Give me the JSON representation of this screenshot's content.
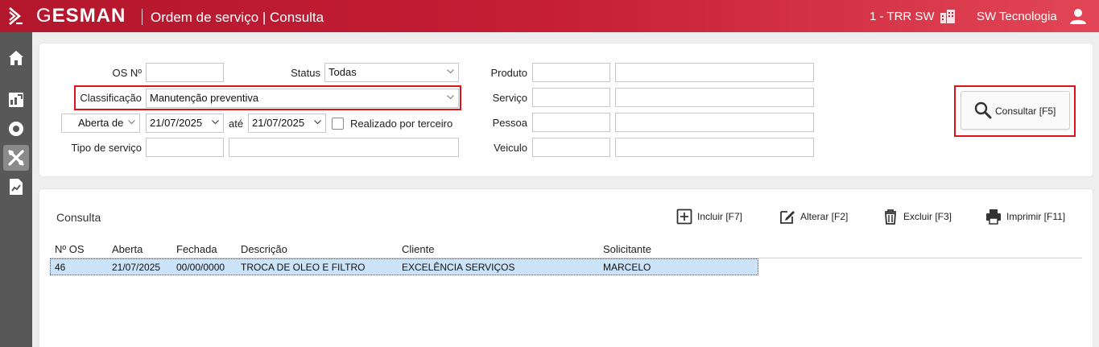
{
  "header": {
    "brand_first": "G",
    "brand_rest": "ESMAN",
    "page_title": "Ordem de serviço | Consulta",
    "company": "1 - TRR SW",
    "user": "SW Tecnologia"
  },
  "sidebar": {
    "items": [
      {
        "icon": "home-icon"
      },
      {
        "icon": "dashboard-icon"
      },
      {
        "icon": "settings-icon"
      },
      {
        "icon": "tools-icon",
        "active": true
      },
      {
        "icon": "report-icon"
      }
    ]
  },
  "filters": {
    "os_label": "OS Nº",
    "os_value": "",
    "status_label": "Status",
    "status_value": "Todas",
    "classificacao_label": "Classificação",
    "classificacao_value": "Manutenção preventiva",
    "date_mode_value": "Aberta de",
    "date_from": "21/07/2025",
    "ate_label": "até",
    "date_to": "21/07/2025",
    "realizado_label": "Realizado por terceiro",
    "realizado_checked": false,
    "tipo_label": "Tipo de serviço",
    "tipo_code": "",
    "tipo_desc": "",
    "produto_label": "Produto",
    "servico_label": "Serviço",
    "pessoa_label": "Pessoa",
    "veiculo_label": "Veiculo",
    "consultar_label": "Consultar [F5]"
  },
  "results": {
    "title": "Consulta",
    "toolbar": {
      "incluir": "Incluir [F7]",
      "alterar": "Alterar [F2]",
      "excluir": "Excluir [F3]",
      "imprimir": "Imprimir [F11]"
    },
    "columns": [
      "Nº OS",
      "Aberta",
      "Fechada",
      "Descrição",
      "Cliente",
      "Solicitante"
    ],
    "rows": [
      [
        "46",
        "21/07/2025",
        "00/00/0000",
        "TROCA DE OLEO E FILTRO",
        "EXCELÊNCIA SERVIÇOS",
        "MARCELO"
      ]
    ]
  },
  "colors": {
    "brand_red": "#c51e35",
    "highlight": "#e0101a",
    "sidebar": "#585858",
    "selected_row": "#cde3f7"
  }
}
